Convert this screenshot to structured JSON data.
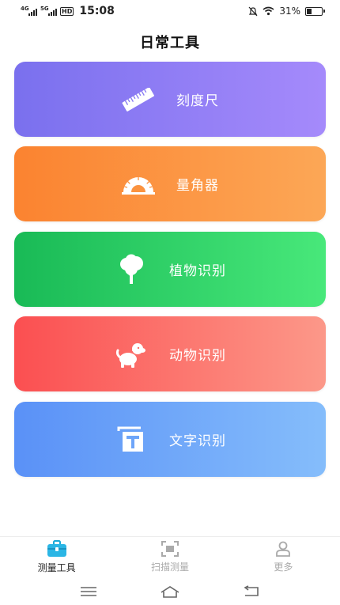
{
  "status": {
    "time": "15:08",
    "battery": "31%",
    "net1": "4G",
    "net2": "5G",
    "hd": "HD",
    "battery_level": 0.31
  },
  "header": {
    "title": "日常工具"
  },
  "tools": [
    {
      "label": "刻度尺",
      "icon": "ruler-icon"
    },
    {
      "label": "量角器",
      "icon": "protractor-icon"
    },
    {
      "label": "植物识别",
      "icon": "tree-icon"
    },
    {
      "label": "动物识别",
      "icon": "dog-icon"
    },
    {
      "label": "文字识别",
      "icon": "text-recognition-icon"
    }
  ],
  "colors": {
    "ruler": "#8a7cf2",
    "protractor": "#fb933f",
    "plant": "#2fce66",
    "animal": "#fc6f69",
    "text": "#6ea5f9"
  },
  "tabbar": [
    {
      "label": "测量工具",
      "icon": "toolbox-icon",
      "active": true
    },
    {
      "label": "扫描测量",
      "icon": "scan-icon",
      "active": false
    },
    {
      "label": "更多",
      "icon": "user-icon",
      "active": false
    }
  ]
}
